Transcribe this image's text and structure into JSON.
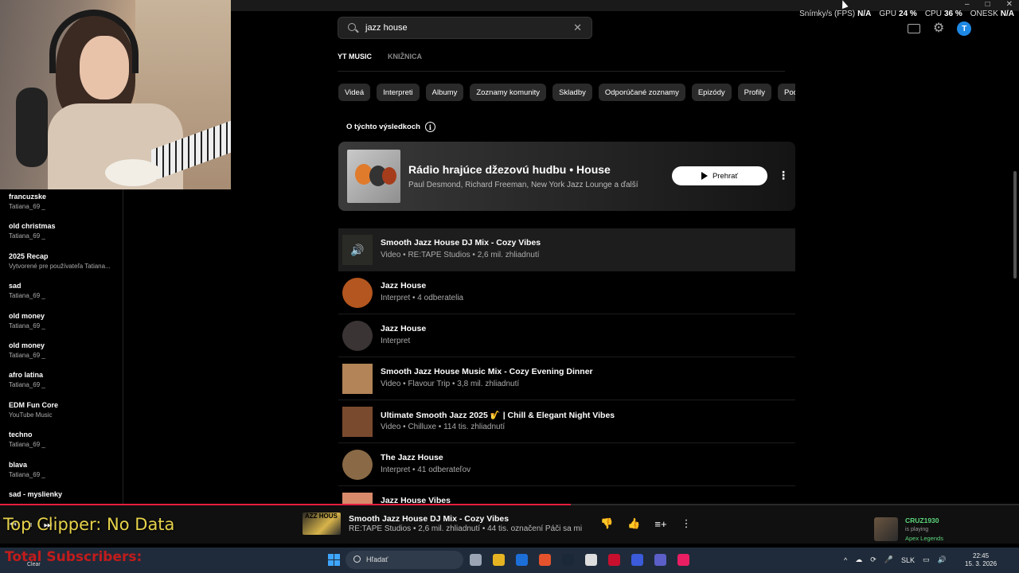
{
  "perf": {
    "fps_label": "Snímky/s (FPS)",
    "fps_value": "N/A",
    "gpu_label": "GPU",
    "gpu_value": "24 %",
    "cpu_label": "CPU",
    "cpu_value": "36 %",
    "onesk_label": "ONESK",
    "onesk_value": "N/A"
  },
  "window_controls": {
    "minimize": "–",
    "maximize": "□",
    "close": "✕"
  },
  "sidebar": {
    "items": [
      {
        "title": "francuzske",
        "sub": "Tatiana_69 _"
      },
      {
        "title": "old christmas",
        "sub": "Tatiana_69 _"
      },
      {
        "title": "2025 Recap",
        "sub": "Vytvorené pre používateľa Tatiana..."
      },
      {
        "title": "sad",
        "sub": "Tatiana_69 _"
      },
      {
        "title": "old money",
        "sub": "Tatiana_69 _"
      },
      {
        "title": "old money",
        "sub": "Tatiana_69 _"
      },
      {
        "title": "afro latina",
        "sub": "Tatiana_69 _"
      },
      {
        "title": "EDM Fun Core",
        "sub": "YouTube Music"
      },
      {
        "title": "techno",
        "sub": "Tatiana_69 _"
      },
      {
        "title": "blava",
        "sub": "Tatiana_69 _"
      },
      {
        "title": "sad - myslienky",
        "sub": ""
      }
    ]
  },
  "search": {
    "query": "jazz house",
    "clear": "✕"
  },
  "header": {
    "avatar_letter": "T",
    "gear": "⚙"
  },
  "tabs": [
    {
      "label": "YT MUSIC",
      "active": true
    },
    {
      "label": "KNIŽNICA",
      "active": false
    }
  ],
  "chips": [
    "Videá",
    "Interpreti",
    "Albumy",
    "Zoznamy komunity",
    "Skladby",
    "Odporúčané zoznamy",
    "Epizódy",
    "Profily",
    "Podc"
  ],
  "about": {
    "label": "O týchto výsledkoch",
    "info": "i"
  },
  "top_result": {
    "title": "Rádio hrajúce džezovú hudbu • House",
    "subtitle": "Paul Desmond, Richard Freeman, New York Jazz Lounge a ďalší",
    "play_label": "Prehrať",
    "more": "⋮"
  },
  "results": [
    {
      "title": "Smooth Jazz House DJ Mix - Cozy Vibes",
      "meta": "Video • RE:TAPE Studios • 2,6 mil. zhliadnutí",
      "shape": "square",
      "color": "#2a2a26",
      "playing": true
    },
    {
      "title": "Jazz House",
      "meta": "Interpret • 4 odberatelia",
      "shape": "round",
      "color": "#b4561f",
      "playing": false
    },
    {
      "title": "Jazz House",
      "meta": "Interpret",
      "shape": "round",
      "color": "#3a3434",
      "playing": false
    },
    {
      "title": "Smooth Jazz House Music Mix - Cozy Evening Dinner",
      "meta": "Video • Flavour Trip • 3,8 mil. zhliadnutí",
      "shape": "square",
      "color": "#b28457",
      "playing": false
    },
    {
      "title": "Ultimate Smooth Jazz 2025 🎷 | Chill & Elegant Night Vibes",
      "meta": "Video • Chilluxe • 114 tis. zhliadnutí",
      "shape": "square",
      "color": "#7a4a2e",
      "playing": false
    },
    {
      "title": "The Jazz House",
      "meta": "Interpret • 41 odberateľov",
      "shape": "round",
      "color": "#8a6a46",
      "playing": false
    },
    {
      "title": "Jazz House Vibes",
      "meta": "",
      "shape": "square",
      "color": "#d88a6a",
      "playing": false
    }
  ],
  "player": {
    "progress_fraction": 0.56,
    "clip_overlay": "Top Clipper: No Data",
    "now_playing_title": "Smooth Jazz House DJ Mix - Cozy Vibes",
    "now_playing_sub": "RE:TAPE Studios • 2,6 mil. zhliadnutí • 44 tis. označení Páči sa mi",
    "thumb_text": "AZZ HOUS",
    "progress_color": "#e41e3f"
  },
  "gamer": {
    "name": "CRUZ1930",
    "status": "is playing",
    "game": "Apex Legends"
  },
  "taskbar": {
    "subscribers_overlay": "Total Subscribers:",
    "clear_label": "Clear",
    "search_label": "Hľadať",
    "lang": "SLK",
    "time": "22:45",
    "date": "15. 3. 2026",
    "apps": [
      "#9aa4b2",
      "#e6b422",
      "#1d6fd8",
      "#e5532d",
      "#1b2838",
      "#dddddd",
      "#c8102e",
      "#3b5bdb",
      "#5b5fc7",
      "#e91e63"
    ]
  }
}
